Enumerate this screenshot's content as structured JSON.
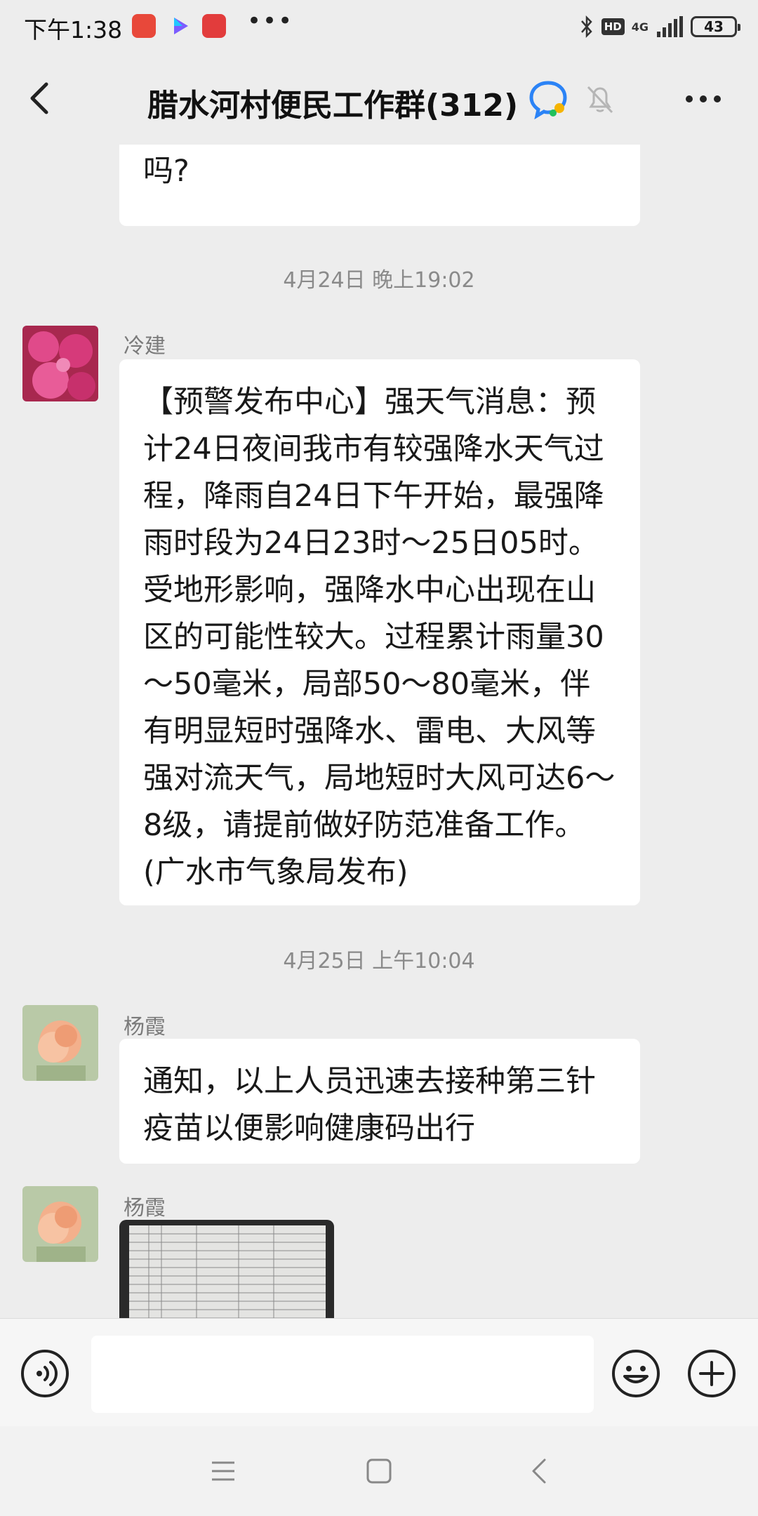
{
  "status_bar": {
    "time": "下午1:38",
    "network": "4G",
    "hd": "HD",
    "battery": "43"
  },
  "header": {
    "title": "腊水河村便民工作群(312)"
  },
  "messages": [
    {
      "type": "text",
      "partial_text": "上海回广东现在是什么政策，能回吗?"
    },
    {
      "type": "timestamp",
      "text": "4月24日 晚上19:02"
    },
    {
      "type": "text",
      "sender": "冷建",
      "text": "【预警发布中心】强天气消息：预计24日夜间我市有较强降水天气过程，降雨自24日下午开始，最强降雨时段为24日23时～25日05时。受地形影响，强降水中心出现在山区的可能性较大。过程累计雨量30～50毫米，局部50～80毫米，伴有明显短时强降水、雷电、大风等强对流天气，局地短时大风可达6～8级，请提前做好防范准备工作。(广水市气象局发布)"
    },
    {
      "type": "timestamp",
      "text": "4月25日 上午10:04"
    },
    {
      "type": "text",
      "sender": "杨霞",
      "text": "通知，以上人员迅速去接种第三针疫苗以便影响健康码出行"
    },
    {
      "type": "image",
      "sender": "杨霞"
    }
  ],
  "input_bar": {
    "placeholder": ""
  },
  "colors": {
    "background": "#ededed",
    "bubble": "#ffffff",
    "sender_name": "#7a7a7a",
    "timestamp": "#8a8a8a"
  },
  "icons": {
    "back": "back-arrow-icon",
    "chat": "chat-bubble-icon",
    "mute": "bell-muted-icon",
    "more": "more-dots-icon",
    "voice": "voice-icon",
    "emoji": "emoji-icon",
    "plus": "plus-icon"
  }
}
